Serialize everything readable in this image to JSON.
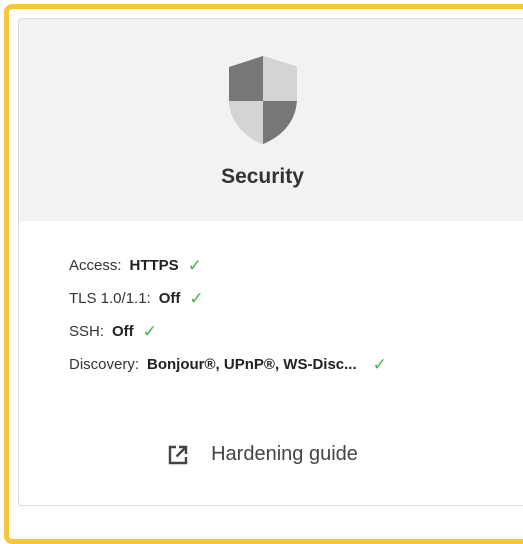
{
  "card": {
    "title": "Security",
    "icon": "shield-icon",
    "accent_color": "#f6c53a",
    "check_color": "#4cae50"
  },
  "status": [
    {
      "key": "Access:",
      "value": "HTTPS",
      "ok": true
    },
    {
      "key": "TLS 1.0/1.1:",
      "value": "Off",
      "ok": true
    },
    {
      "key": "SSH:",
      "value": "Off",
      "ok": true
    },
    {
      "key": "Discovery:",
      "value": "Bonjour®, UPnP®, WS-Disc...",
      "ok": true
    }
  ],
  "link": {
    "label": "Hardening guide",
    "icon": "external-link-icon"
  }
}
